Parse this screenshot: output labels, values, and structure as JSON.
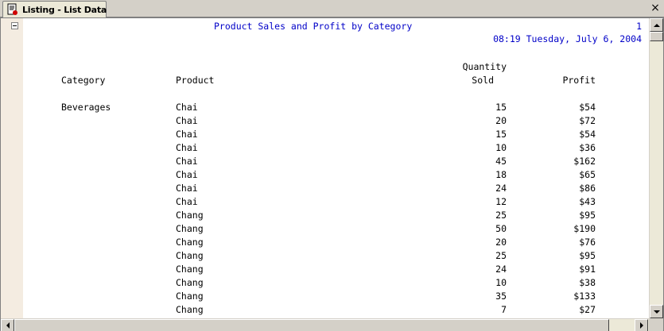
{
  "tab": {
    "label": "Listing - List Data",
    "icon": "listing-document-icon",
    "close_glyph": "×"
  },
  "report": {
    "title": "Product Sales and Profit by Category",
    "page_number": "1",
    "datetime": "08:19 Tuesday, July 6, 2004",
    "headers": {
      "category": "Category",
      "product": "Product",
      "quantity_line1": "Quantity",
      "quantity_line2": "Sold",
      "profit": "Profit"
    },
    "category_value": "Beverages",
    "rows": [
      {
        "product": "Chai",
        "quantity": "15",
        "profit": "$54"
      },
      {
        "product": "Chai",
        "quantity": "20",
        "profit": "$72"
      },
      {
        "product": "Chai",
        "quantity": "15",
        "profit": "$54"
      },
      {
        "product": "Chai",
        "quantity": "10",
        "profit": "$36"
      },
      {
        "product": "Chai",
        "quantity": "45",
        "profit": "$162"
      },
      {
        "product": "Chai",
        "quantity": "18",
        "profit": "$65"
      },
      {
        "product": "Chai",
        "quantity": "24",
        "profit": "$86"
      },
      {
        "product": "Chai",
        "quantity": "12",
        "profit": "$43"
      },
      {
        "product": "Chang",
        "quantity": "25",
        "profit": "$95"
      },
      {
        "product": "Chang",
        "quantity": "50",
        "profit": "$190"
      },
      {
        "product": "Chang",
        "quantity": "20",
        "profit": "$76"
      },
      {
        "product": "Chang",
        "quantity": "25",
        "profit": "$95"
      },
      {
        "product": "Chang",
        "quantity": "24",
        "profit": "$91"
      },
      {
        "product": "Chang",
        "quantity": "10",
        "profit": "$38"
      },
      {
        "product": "Chang",
        "quantity": "35",
        "profit": "$133"
      },
      {
        "product": "Chang",
        "quantity": "7",
        "profit": "$27"
      }
    ]
  },
  "colors": {
    "title_blue": "#0000c8",
    "gutter": "#f4ece1"
  }
}
